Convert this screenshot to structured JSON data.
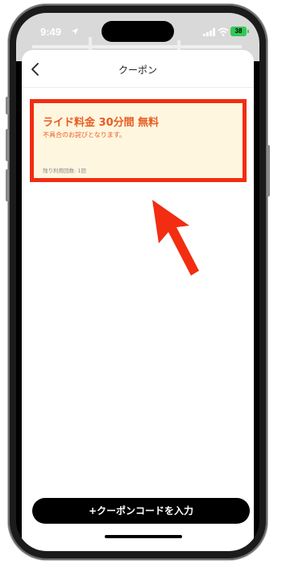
{
  "status_bar": {
    "time": "9:49",
    "battery": "38",
    "icons": [
      "location-arrow-icon",
      "signal-icon",
      "wifi-icon",
      "battery-icon"
    ]
  },
  "header": {
    "title": "クーポン",
    "back_icon": "chevron-left-icon"
  },
  "coupon": {
    "title": "ライド料金 30分間 無料",
    "description": "不具合のお詫びとなります。",
    "remaining": "残り利用回数: 1回"
  },
  "annotations": {
    "highlight_color": "#f22d12",
    "arrow_color": "#f22d12"
  },
  "footer": {
    "add_button_label": "+クーポンコードを入力"
  },
  "colors": {
    "coupon_bg": "#fff6e0",
    "coupon_text": "#e85c1f",
    "button_bg": "#000000",
    "battery": "#34c759"
  }
}
